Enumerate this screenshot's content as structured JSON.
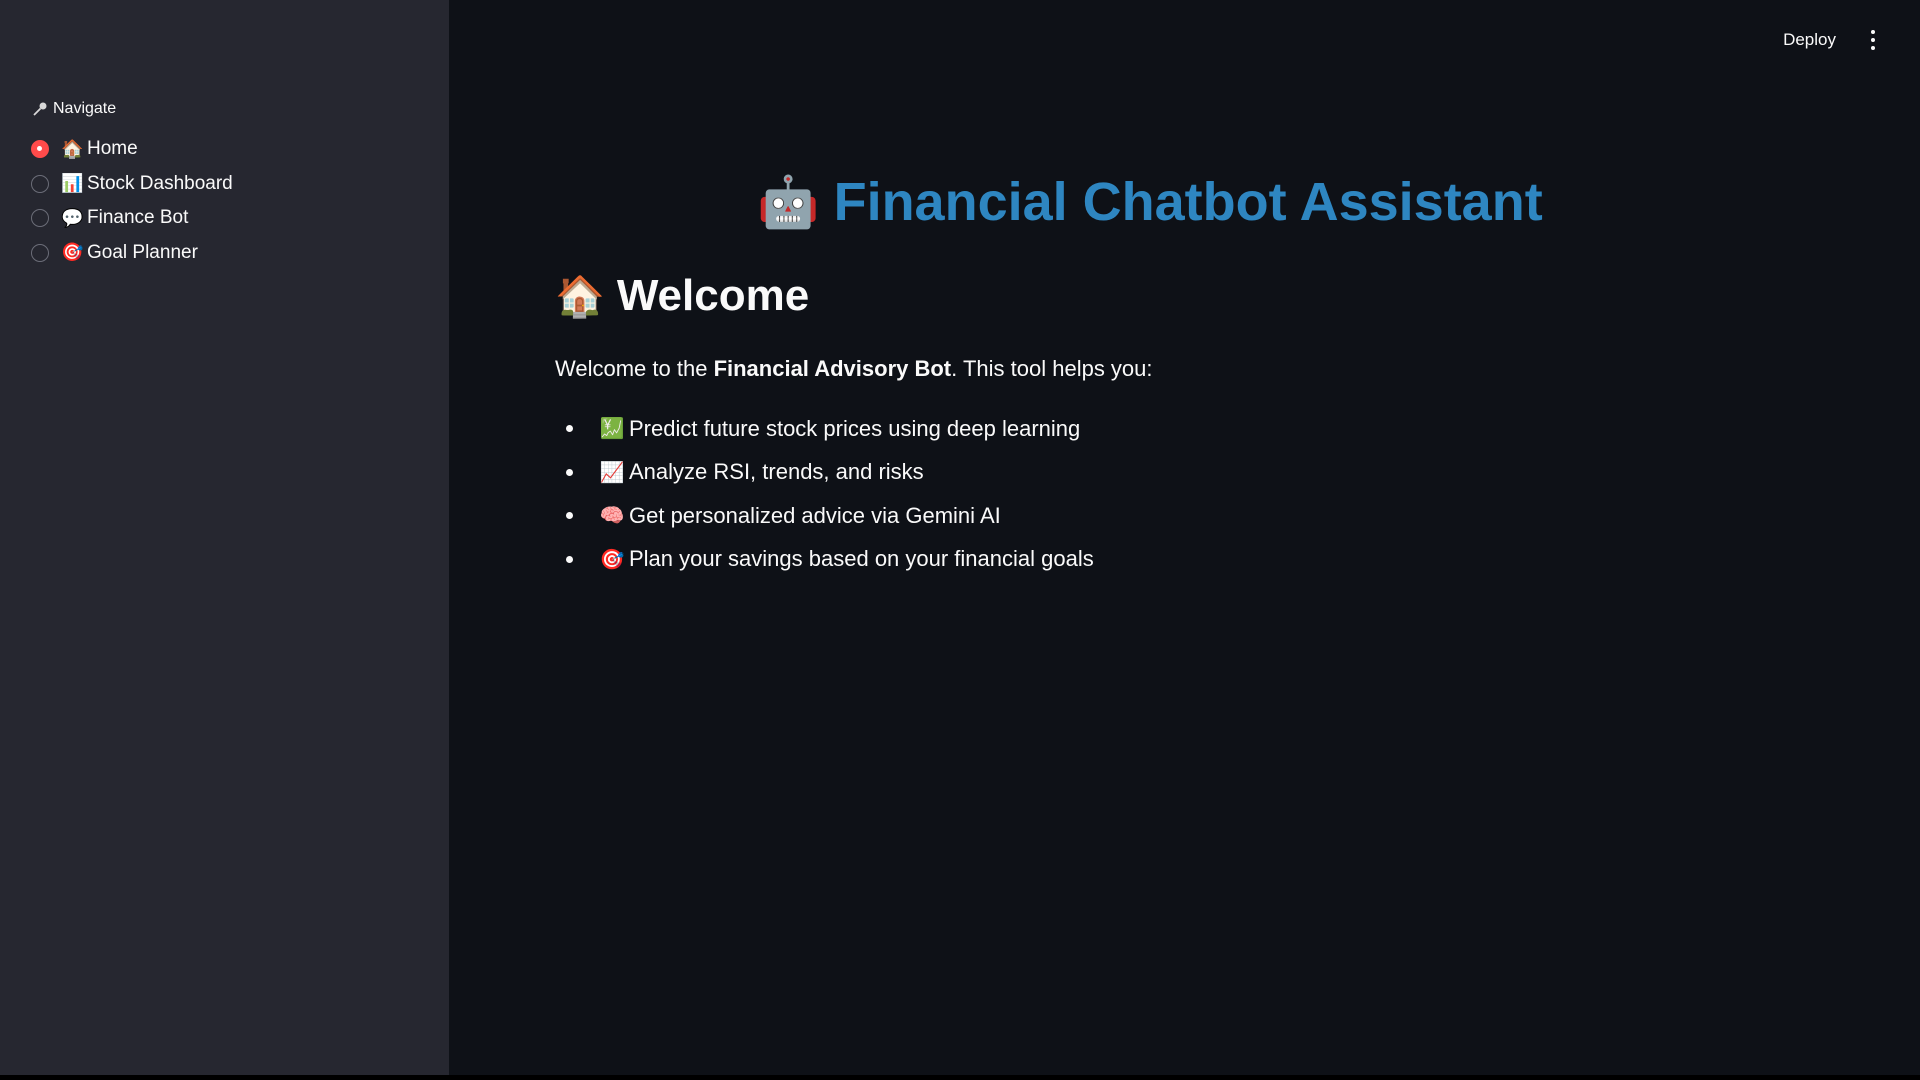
{
  "sidebar": {
    "nav_label": "Navigate",
    "nav_icon": "key-icon",
    "items": [
      {
        "label": "Home",
        "emoji": "🏠",
        "icon": "house-icon",
        "selected": true
      },
      {
        "label": "Stock Dashboard",
        "emoji": "📊",
        "icon": "bar-chart-icon",
        "selected": false
      },
      {
        "label": "Finance Bot",
        "emoji": "💬",
        "icon": "speech-bubble-icon",
        "selected": false
      },
      {
        "label": "Goal Planner",
        "emoji": "🎯",
        "icon": "target-icon",
        "selected": false
      }
    ]
  },
  "toolbar": {
    "deploy_label": "Deploy",
    "menu_icon": "vertical-ellipsis-icon"
  },
  "main": {
    "title_emoji": "🤖",
    "title": "Financial Chatbot Assistant",
    "heading_emoji": "🏠",
    "heading": "Welcome",
    "intro_prefix": "Welcome to the ",
    "intro_bold": "Financial Advisory Bot",
    "intro_suffix": ". This tool helps you:",
    "features": [
      {
        "emoji": "💹",
        "icon": "chart-yen-icon",
        "text": "Predict future stock prices using deep learning"
      },
      {
        "emoji": "📈",
        "icon": "chart-increasing-icon",
        "text": "Analyze RSI, trends, and risks"
      },
      {
        "emoji": "🧠",
        "icon": "brain-icon",
        "text": "Get personalized advice via Gemini AI"
      },
      {
        "emoji": "🎯",
        "icon": "target-icon",
        "text": "Plan your savings based on your financial goals"
      }
    ]
  },
  "colors": {
    "sidebar_bg": "#262730",
    "main_bg": "#0e1117",
    "title": "#2e86c1",
    "accent": "#ff4b4b",
    "text": "#fafafa"
  }
}
